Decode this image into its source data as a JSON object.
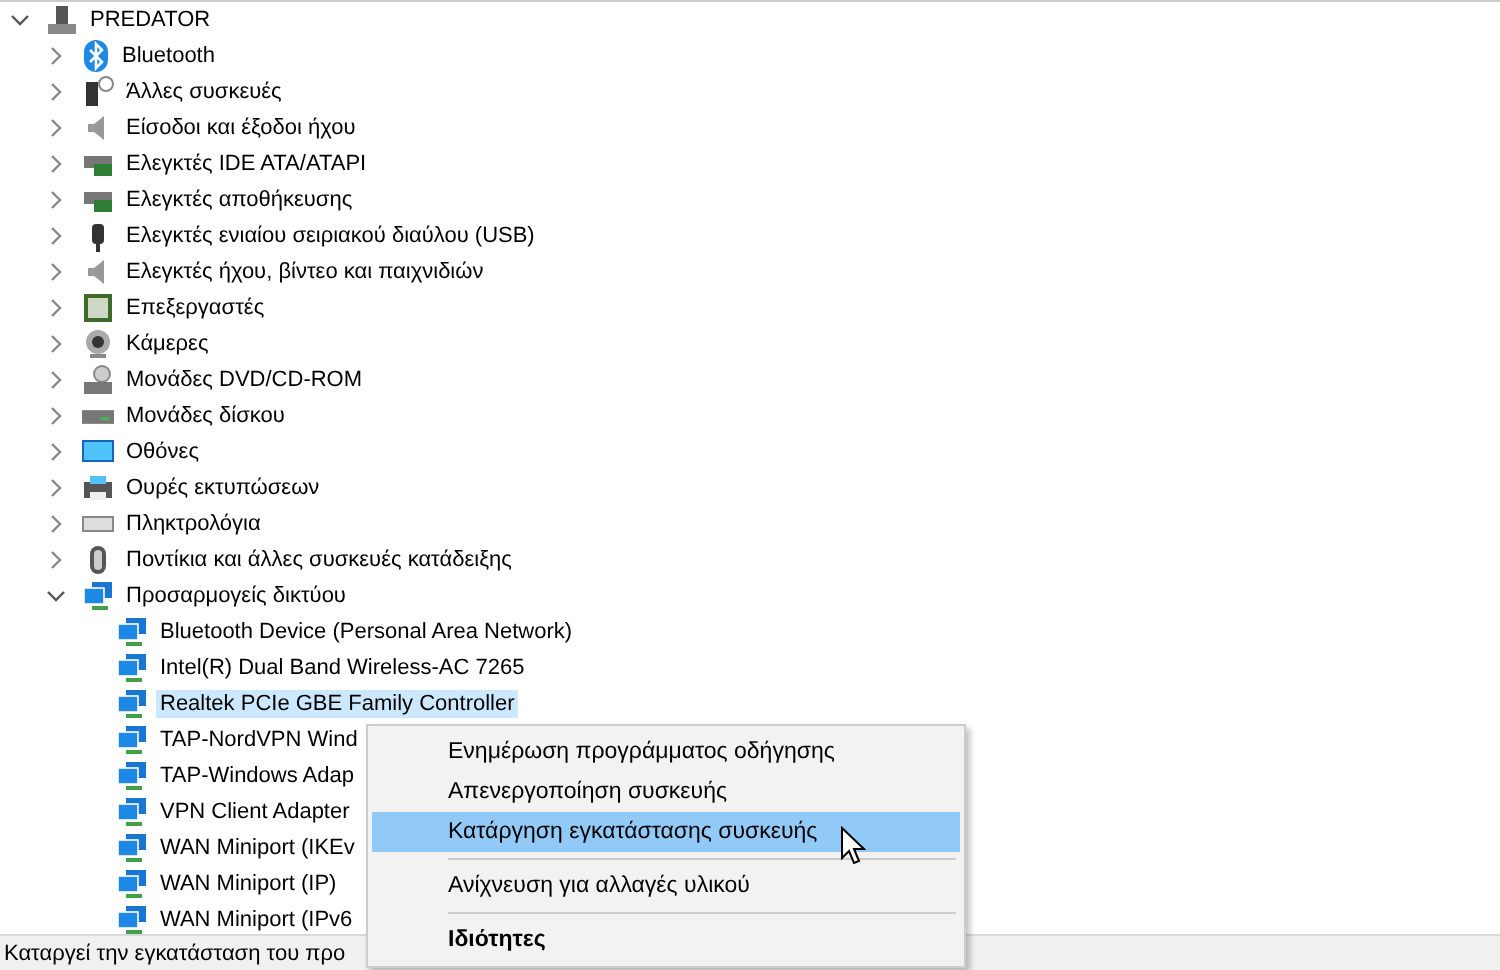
{
  "tree": {
    "label": "PREDATOR",
    "expanded": true,
    "children": [
      {
        "label": "Bluetooth",
        "expanded": false
      },
      {
        "label": "Άλλες συσκευές",
        "expanded": false
      },
      {
        "label": "Είσοδοι και έξοδοι ήχου",
        "expanded": false
      },
      {
        "label": "Ελεγκτές IDE ATA/ATAPI",
        "expanded": false
      },
      {
        "label": "Ελεγκτές αποθήκευσης",
        "expanded": false
      },
      {
        "label": "Ελεγκτές ενιαίου σειριακού διαύλου (USB)",
        "expanded": false
      },
      {
        "label": "Ελεγκτές ήχου, βίντεο και παιχνιδιών",
        "expanded": false
      },
      {
        "label": "Επεξεργαστές",
        "expanded": false
      },
      {
        "label": "Κάμερες",
        "expanded": false
      },
      {
        "label": "Μονάδες DVD/CD-ROM",
        "expanded": false
      },
      {
        "label": "Μονάδες δίσκου",
        "expanded": false
      },
      {
        "label": "Οθόνες",
        "expanded": false
      },
      {
        "label": "Ουρές εκτυπώσεων",
        "expanded": false
      },
      {
        "label": "Πληκτρολόγια",
        "expanded": false
      },
      {
        "label": "Ποντίκια και άλλες συσκευές κατάδειξης",
        "expanded": false
      },
      {
        "label": "Προσαρμογείς δικτύου",
        "expanded": true,
        "children": [
          {
            "label": "Bluetooth Device (Personal Area Network)",
            "selected": false
          },
          {
            "label": "Intel(R) Dual Band Wireless-AC 7265",
            "selected": false
          },
          {
            "label": "Realtek PCIe GBE Family Controller",
            "selected": true
          },
          {
            "label": "TAP-NordVPN Wind",
            "selected": false
          },
          {
            "label": "TAP-Windows Adap",
            "selected": false
          },
          {
            "label": "VPN Client Adapter",
            "selected": false
          },
          {
            "label": "WAN Miniport (IKEv",
            "selected": false
          },
          {
            "label": "WAN Miniport (IP)",
            "selected": false
          },
          {
            "label": "WAN Miniport (IPv6",
            "selected": false
          }
        ]
      }
    ]
  },
  "context_menu": [
    {
      "label": "Ενημέρωση προγράμματος οδήγησης",
      "selected": false,
      "bold": false,
      "separator_before": false
    },
    {
      "label": "Απενεργοποίηση συσκευής",
      "selected": false,
      "bold": false,
      "separator_before": false
    },
    {
      "label": "Κατάργηση εγκατάστασης συσκευής",
      "selected": true,
      "bold": false,
      "separator_before": false
    },
    {
      "label": "Ανίχνευση για αλλαγές υλικού",
      "selected": false,
      "bold": false,
      "separator_before": true
    },
    {
      "label": "Ιδιότητες",
      "selected": false,
      "bold": true,
      "separator_before": true
    }
  ],
  "status_bar": "Καταργεί την εγκατάσταση του προ"
}
